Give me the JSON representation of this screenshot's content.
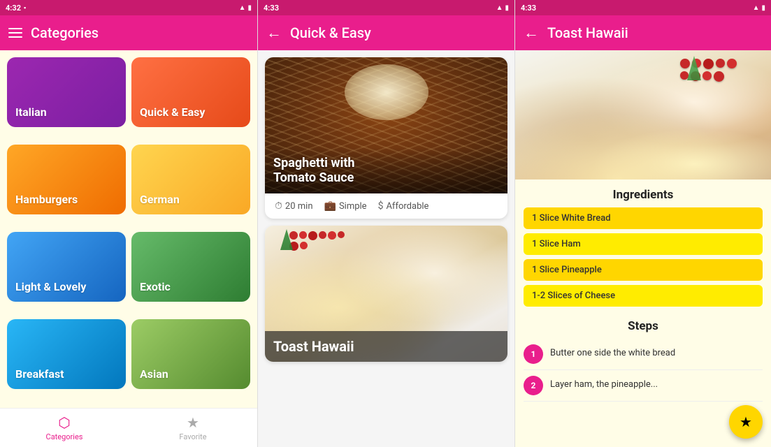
{
  "panel1": {
    "statusBar": {
      "time": "4:32",
      "rightIcons": "signal wifi battery"
    },
    "appBar": {
      "title": "Categories",
      "menuIcon": "menu-icon"
    },
    "categories": [
      {
        "id": "italian",
        "label": "Italian",
        "colorClass": "cat-italian"
      },
      {
        "id": "quick",
        "label": "Quick & Easy",
        "colorClass": "cat-quick"
      },
      {
        "id": "hamburgers",
        "label": "Hamburgers",
        "colorClass": "cat-hamburger"
      },
      {
        "id": "german",
        "label": "German",
        "colorClass": "cat-german"
      },
      {
        "id": "light",
        "label": "Light & Lovely",
        "colorClass": "cat-light"
      },
      {
        "id": "exotic",
        "label": "Exotic",
        "colorClass": "cat-exotic"
      },
      {
        "id": "breakfast",
        "label": "Breakfast",
        "colorClass": "cat-breakfast"
      },
      {
        "id": "asian",
        "label": "Asian",
        "colorClass": "cat-asian"
      }
    ],
    "bottomNav": [
      {
        "id": "categories",
        "label": "Categories",
        "icon": "⬡",
        "active": true
      },
      {
        "id": "favorites",
        "label": "Favorite",
        "icon": "★",
        "active": false
      }
    ]
  },
  "panel2": {
    "statusBar": {
      "time": "4:33"
    },
    "appBar": {
      "title": "Quick & Easy",
      "backIcon": "back-icon"
    },
    "recipes": [
      {
        "id": "spaghetti",
        "title": "Spaghetti with\nTomato Sauce",
        "time": "20 min",
        "difficulty": "Simple",
        "cost": "Affordable"
      },
      {
        "id": "toast-hawaii",
        "title": "Toast Hawaii"
      }
    ]
  },
  "panel3": {
    "statusBar": {
      "time": "4:33"
    },
    "appBar": {
      "title": "Toast Hawaii",
      "backIcon": "back-icon"
    },
    "ingredientsTitle": "Ingredients",
    "ingredients": [
      {
        "id": "ing1",
        "label": "1 Slice White Bread",
        "colorClass": "ing-yellow"
      },
      {
        "id": "ing2",
        "label": "1 Slice Ham",
        "colorClass": "ing-light"
      },
      {
        "id": "ing3",
        "label": "1 Slice Pineapple",
        "colorClass": "ing-yellow"
      },
      {
        "id": "ing4",
        "label": "1-2 Slices of Cheese",
        "colorClass": "ing-light"
      }
    ],
    "stepsTitle": "Steps",
    "steps": [
      {
        "number": "1",
        "text": "Butter one side the white bread"
      },
      {
        "number": "2",
        "text": "Layer ham, the pineapple..."
      }
    ],
    "fabIcon": "★"
  }
}
